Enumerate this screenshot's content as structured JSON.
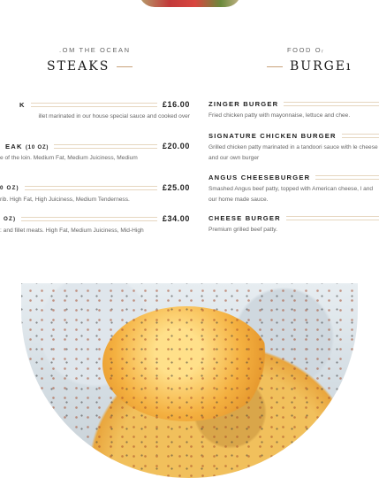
{
  "left_section": {
    "eyebrow": ".OM THE OCEAN",
    "heading": "STEAKS",
    "items": [
      {
        "name": "K",
        "size": "",
        "price": "£16.00",
        "desc": "illet marinated in our house special sauce and cooked over"
      },
      {
        "name": "EAK",
        "size": "(10 OZ)",
        "price": "£20.00",
        "desc": "e of the loin. Medium Fat, Medium Juiciness, Medium"
      },
      {
        "name": "0 OZ)",
        "size": "",
        "price": "£25.00",
        "desc": "rib. High Fat, High Juiciness, Medium Tenderness."
      },
      {
        "name": "OZ)",
        "size": "",
        "price": "£34.00",
        "desc": ": and fillet meats. High Fat, Medium Juiciness, Mid-High"
      }
    ]
  },
  "right_section": {
    "eyebrow": "FOOD Oᵣ",
    "heading": "BURGEı",
    "items": [
      {
        "name": "ZINGER BURGER",
        "desc": "Fried chicken patty with mayonnaise, lettuce and chee."
      },
      {
        "name": "SIGNATURE CHICKEN BURGER",
        "desc": "Grilled chicken patty marinated in a tandoori sauce with le cheese and our own burger"
      },
      {
        "name": "ANGUS CHEESEBURGER",
        "desc": "Smashed Angus beef patty, topped with American cheese, l and our home made sauce."
      },
      {
        "name": "CHEESE BURGER",
        "desc": "Premium grilled beef patty."
      }
    ]
  },
  "colors": {
    "accent_rule": "#c9a37a",
    "leader": "#e6d6bf",
    "heading": "#1c1c1c",
    "body_text": "#666666"
  }
}
